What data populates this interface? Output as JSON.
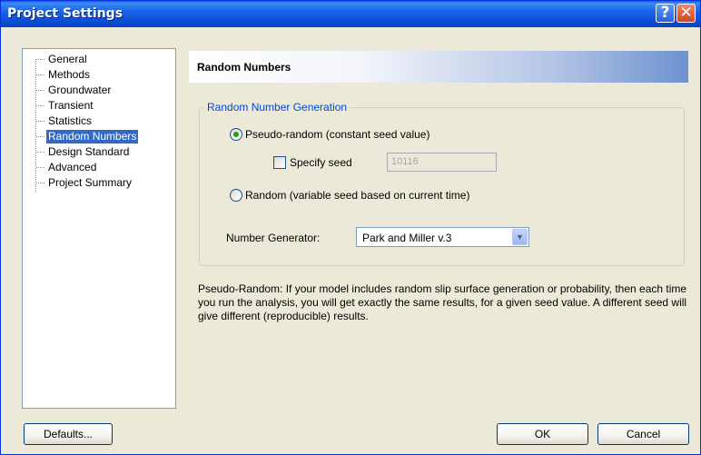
{
  "window": {
    "title": "Project Settings"
  },
  "tree": {
    "items": [
      {
        "label": "General"
      },
      {
        "label": "Methods"
      },
      {
        "label": "Groundwater"
      },
      {
        "label": "Transient"
      },
      {
        "label": "Statistics"
      },
      {
        "label": "Random Numbers",
        "selected": true
      },
      {
        "label": "Design Standard"
      },
      {
        "label": "Advanced"
      },
      {
        "label": "Project Summary"
      }
    ]
  },
  "section": {
    "title": "Random Numbers"
  },
  "group": {
    "legend": "Random Number Generation",
    "pseudo_random_label": "Pseudo-random (constant seed value)",
    "pseudo_random_selected": true,
    "specify_seed_label": "Specify seed",
    "specify_seed_checked": false,
    "seed_value": "10116",
    "random_label": "Random (variable seed based on current time)",
    "random_selected": false,
    "generator_label": "Number Generator:",
    "generator_value": "Park and Miller v.3"
  },
  "description": "Pseudo-Random: If your model includes random slip surface generation or probability, then each time you run the analysis, you will get exactly the same results, for a given seed value. A different seed will give different (reproducible) results.",
  "buttons": {
    "defaults": "Defaults...",
    "ok": "OK",
    "cancel": "Cancel"
  },
  "colors": {
    "titlebar": "#0a4fd6",
    "selection": "#316ac5",
    "legend_text": "#0046d5",
    "radio_fill": "#21a121"
  }
}
